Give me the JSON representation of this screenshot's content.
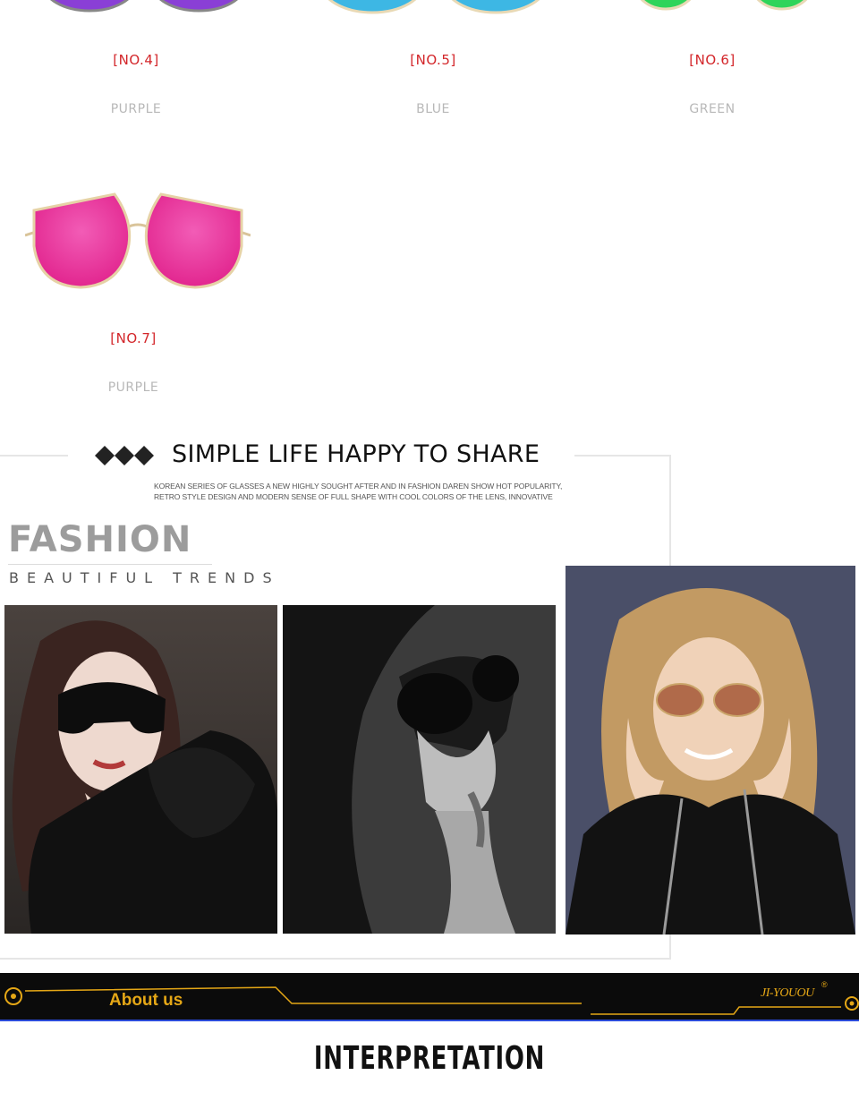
{
  "variants": [
    {
      "code": "[NO.4]",
      "color_name": "PURPLE",
      "lens_color": "#8a3fd6"
    },
    {
      "code": "[NO.5]",
      "color_name": "BLUE",
      "lens_color": "#3db7e4"
    },
    {
      "code": "[NO.6]",
      "color_name": "GREEN",
      "lens_color": "#2fd45a"
    },
    {
      "code": "[NO.7]",
      "color_name": "PURPLE",
      "lens_color": "#ee3aa6"
    }
  ],
  "share": {
    "title": "SIMPLE LIFE HAPPY TO SHARE",
    "subtitle": "KOREAN SERIES OF GLASSES A NEW HIGHLY SOUGHT AFTER AND IN FASHION DAREN SHOW HOT POPULARITY, RETRO STYLE DESIGN AND MODERN SENSE OF FULL SHAPE WITH COOL COLORS OF THE LENS, INNOVATIVE"
  },
  "fashion": {
    "heading": "FASHION",
    "tagline": "BEAUTIFUL TRENDS"
  },
  "photos": [
    {
      "icon": "model-photo-lace-dress"
    },
    {
      "icon": "model-photo-monochrome"
    },
    {
      "icon": "model-photo-aviators"
    }
  ],
  "about": {
    "label": "About us",
    "brand": "JI-YOUOU",
    "trademark": "®"
  },
  "interpretation": "INTERPRETATION",
  "colors": {
    "accent_red": "#d3262a",
    "accent_gold": "#e5a716",
    "bar_blue": "#2a4ad8"
  }
}
